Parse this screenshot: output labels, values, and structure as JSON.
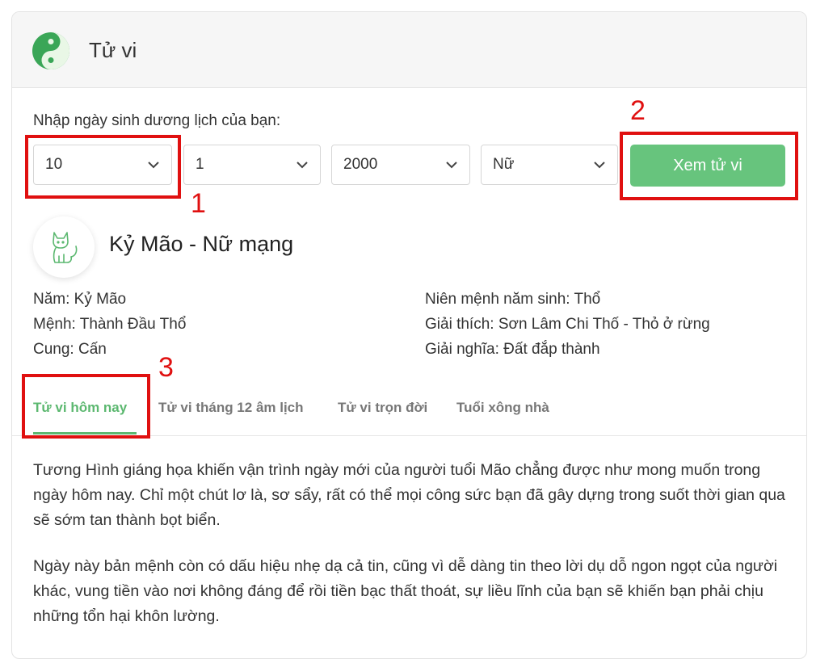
{
  "header": {
    "title": "Tử vi",
    "logo_icon": "yin-yang-icon"
  },
  "form": {
    "prompt": "Nhập ngày sinh dương lịch của bạn:",
    "day": "10",
    "month": "1",
    "year": "2000",
    "gender": "Nữ",
    "submit_label": "Xem tử vi"
  },
  "result": {
    "avatar_icon": "cat-icon",
    "title": "Kỷ Mão - Nữ mạng",
    "left": [
      "Năm: Kỷ Mão",
      "Mệnh: Thành Đầu Thổ",
      "Cung: Cấn"
    ],
    "right": [
      "Niên mệnh năm sinh: Thổ",
      "Giải thích: Sơn Lâm Chi Thố - Thỏ ở rừng",
      "Giải nghĩa: Đất đắp thành"
    ]
  },
  "tabs": [
    {
      "label": "Tử vi hôm nay",
      "active": true
    },
    {
      "label": "Tử vi tháng 12 âm lịch",
      "active": false
    },
    {
      "label": "Tử vi trọn đời",
      "active": false
    },
    {
      "label": "Tuổi xông nhà",
      "active": false
    }
  ],
  "content": {
    "paragraphs": [
      "Tương Hình giáng họa khiến vận trình ngày mới của người tuổi Mão chẳng được như mong muốn trong ngày hôm nay. Chỉ một chút lơ là, sơ sẩy, rất có thể mọi công sức bạn đã gây dựng trong suốt thời gian qua sẽ sớm tan thành bọt biển.",
      "Ngày này bản mệnh còn có dấu hiệu nhẹ dạ cả tin, cũng vì dễ dàng tin theo lời dụ dỗ ngon ngọt của người khác, vung tiền vào nơi không đáng để rồi tiền bạc thất thoát, sự liều lĩnh của bạn sẽ khiến bạn phải chịu những tổn hại khôn lường."
    ]
  },
  "annotations": {
    "one": "1",
    "two": "2",
    "three": "3"
  },
  "colors": {
    "accent": "#5cb870",
    "button": "#67c47d",
    "annotation": "#e01010"
  }
}
